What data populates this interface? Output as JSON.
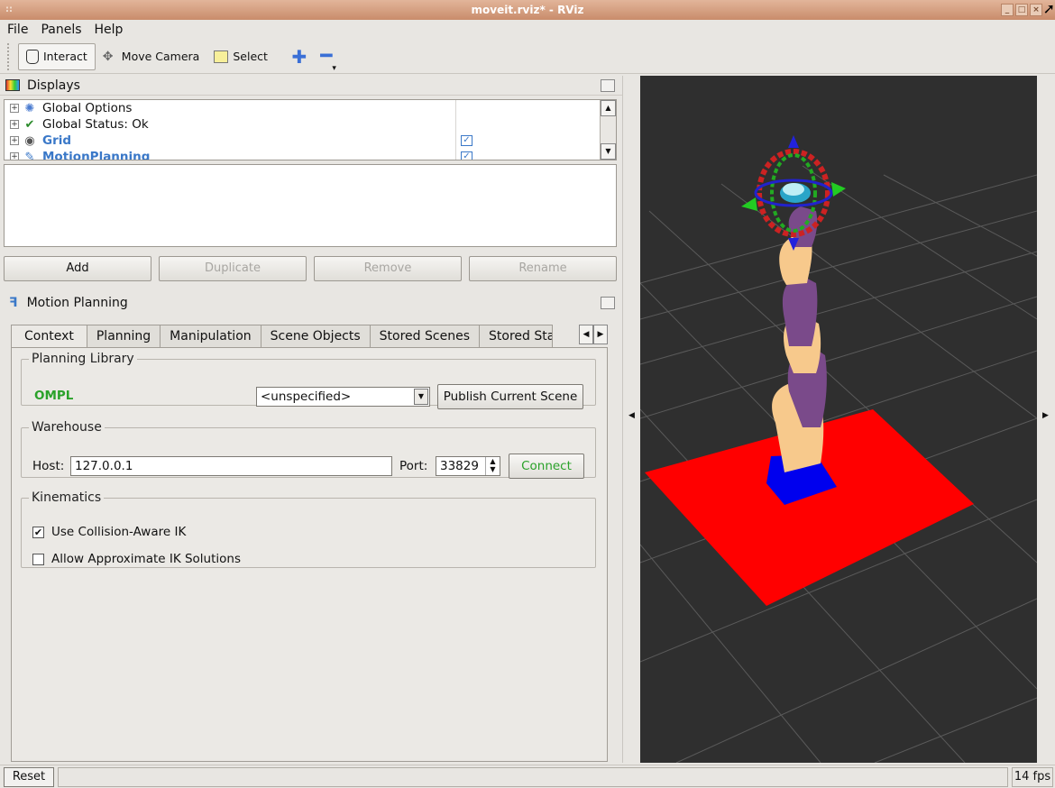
{
  "window": {
    "title": "moveit.rviz* - RViz",
    "wm_label": "::"
  },
  "menu": {
    "items": [
      "File",
      "Panels",
      "Help"
    ]
  },
  "toolbar": {
    "tools": [
      {
        "label": "Interact",
        "icon": "hand-icon",
        "active": true
      },
      {
        "label": "Move Camera",
        "icon": "move-camera-icon"
      },
      {
        "label": "Select",
        "icon": "select-icon"
      }
    ],
    "add_icon": "plus-icon",
    "remove_icon": "minus-icon"
  },
  "displays": {
    "title": "Displays",
    "items": [
      {
        "label": "Global Options",
        "icon": "gear-icon"
      },
      {
        "label": "Global Status: Ok",
        "icon": "check-icon"
      },
      {
        "label": "Grid",
        "icon": "eye-icon",
        "checked": true
      },
      {
        "label": "MotionPlanning",
        "icon": "arm-icon",
        "checked": true
      }
    ],
    "buttons": {
      "add": "Add",
      "duplicate": "Duplicate",
      "remove": "Remove",
      "rename": "Rename"
    }
  },
  "motion_planning": {
    "title": "Motion Planning",
    "tabs": [
      "Context",
      "Planning",
      "Manipulation",
      "Scene Objects",
      "Stored Scenes",
      "Stored Stat"
    ],
    "planning_library": {
      "legend": "Planning Library",
      "library": "OMPL",
      "planner": "<unspecified>",
      "publish_button": "Publish Current Scene"
    },
    "warehouse": {
      "legend": "Warehouse",
      "host_label": "Host:",
      "host_value": "127.0.0.1",
      "port_label": "Port:",
      "port_value": "33829",
      "connect_button": "Connect"
    },
    "kinematics": {
      "legend": "Kinematics",
      "collision_aware_ik": {
        "label": "Use Collision-Aware IK",
        "checked": true
      },
      "approx_ik": {
        "label": "Allow Approximate IK Solutions",
        "checked": false
      }
    }
  },
  "status": {
    "reset": "Reset",
    "fps": "14 fps"
  },
  "colors": {
    "ok_green": "#2aa22a",
    "link_blue": "#3a78c8",
    "floor_red": "#ff0000",
    "base_blue": "#0000ff",
    "arm_tan": "#f7c98c",
    "arm_purple": "#7a4a8a"
  }
}
